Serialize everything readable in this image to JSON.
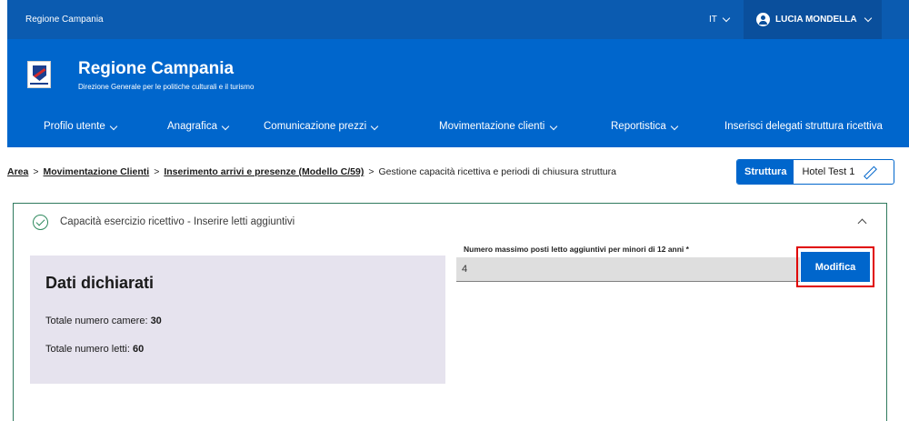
{
  "topbar": {
    "brand": "Regione Campania",
    "language": "IT",
    "user_name": "LUCIA MONDELLA"
  },
  "header": {
    "title": "Regione Campania",
    "subtitle": "Direzione Generale per le politiche culturali e il turismo"
  },
  "nav": {
    "items": [
      {
        "label": "Profilo utente"
      },
      {
        "label": "Anagrafica"
      },
      {
        "label": "Comunicazione prezzi"
      },
      {
        "label": "Movimentazione clienti"
      },
      {
        "label": "Reportistica"
      },
      {
        "label": "Inserisci delegati struttura ricettiva"
      }
    ]
  },
  "breadcrumb": {
    "items": [
      "Area",
      "Movimentazione Clienti",
      "Inserimento arrivi e presenze (Modello C/59)"
    ],
    "current": "Gestione capacità ricettiva e periodi di chiusura struttura",
    "separator": ">"
  },
  "struttura": {
    "label": "Struttura",
    "value": "Hotel Test 1"
  },
  "card": {
    "title": "Capacità esercizio ricettivo - Inserire letti aggiuntivi"
  },
  "form": {
    "field_label": "Numero massimo posti letto aggiuntivi per minori di 12 anni *",
    "field_value": "4",
    "button_label": "Modifica"
  },
  "dati": {
    "title": "Dati dichiarati",
    "camere_label": "Totale numero camere:",
    "camere_value": "30",
    "letti_label": "Totale numero letti:",
    "letti_value": "60"
  },
  "colors": {
    "topbar": "#0b5bb0",
    "header": "#0066cc",
    "highlight_frame": "#e00000",
    "card_border": "#2f7a5e",
    "panel_bg": "#e6e3ee"
  }
}
